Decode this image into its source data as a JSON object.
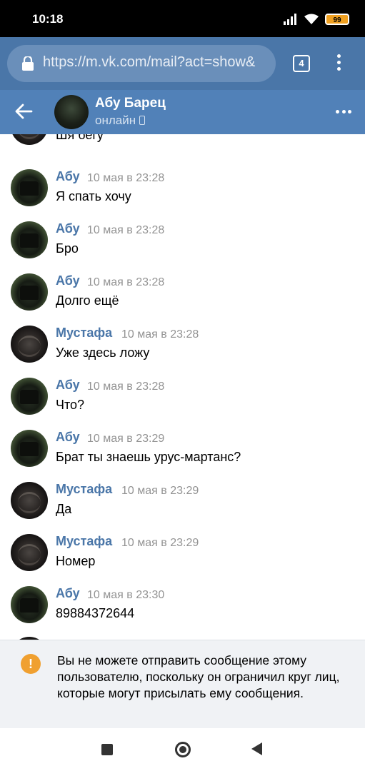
{
  "status_bar": {
    "time": "10:18",
    "battery": "99"
  },
  "browser": {
    "url": "https://m.vk.com/mail?act=show&",
    "tab_count": "4"
  },
  "chat": {
    "name": "Абу Барец",
    "status": "онлайн"
  },
  "partial_message": {
    "text": "Шя бегу"
  },
  "messages": [
    {
      "author": "Абу",
      "time": "10 мая в 23:28",
      "text": "Я спать хочу"
    },
    {
      "author": "Абу",
      "time": "10 мая в 23:28",
      "text": "Бро"
    },
    {
      "author": "Абу",
      "time": "10 мая в 23:28",
      "text": "Долго ещё"
    },
    {
      "author": "Мустафа",
      "time": "10 мая в 23:28",
      "text": "Уже здесь ложу"
    },
    {
      "author": "Абу",
      "time": "10 мая в 23:28",
      "text": "Что?"
    },
    {
      "author": "Абу",
      "time": "10 мая в 23:29",
      "text": "Брат ты знаешь урус-мартанс?"
    },
    {
      "author": "Мустафа",
      "time": "10 мая в 23:29",
      "text": "Да"
    },
    {
      "author": "Мустафа",
      "time": "10 мая в 23:29",
      "text": "Номер"
    },
    {
      "author": "Абу",
      "time": "10 мая в 23:30",
      "text": "89884372644"
    }
  ],
  "notice": {
    "icon": "warning-icon",
    "text": "Вы не можете отправить сообщение этому пользователю, поскольку он ограничил круг лиц, которые могут присылать ему сообщения."
  },
  "colors": {
    "header": "#5181b8",
    "browser": "#4a76a8",
    "author": "#4a76a8",
    "warning": "#f0a030"
  }
}
